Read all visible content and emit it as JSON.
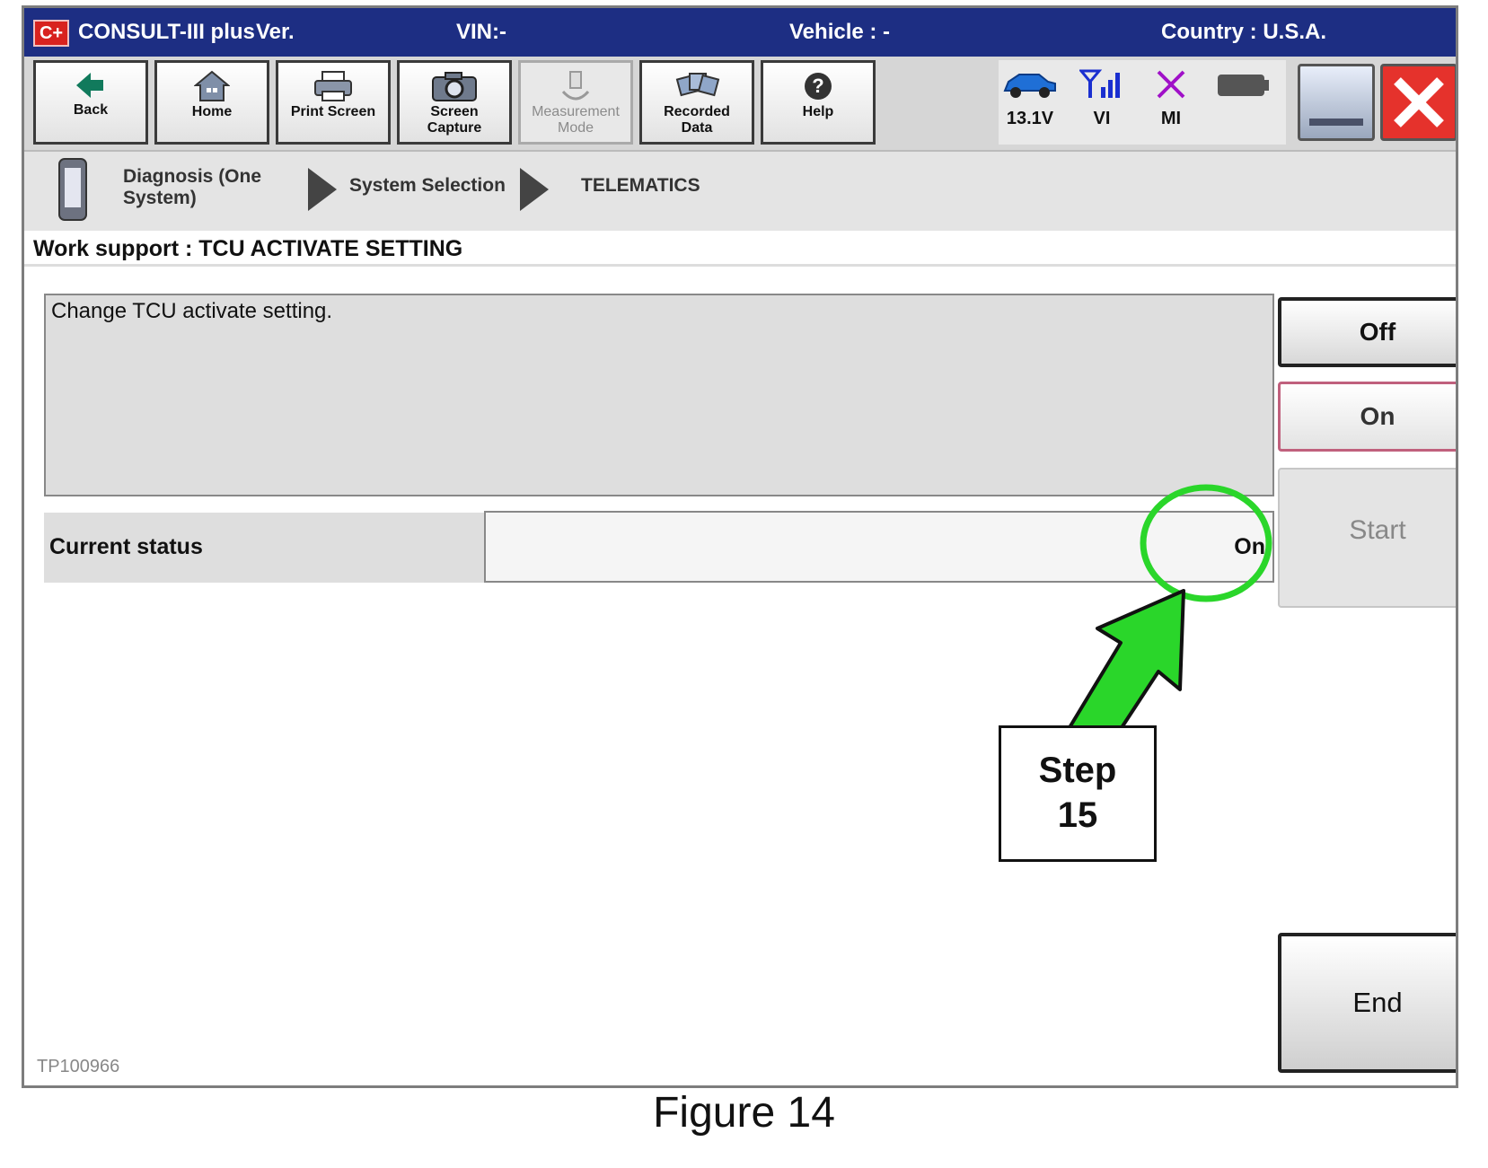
{
  "titlebar": {
    "app": "CONSULT-III plus",
    "ver": "Ver.",
    "vin": "VIN:-",
    "vehicle": "Vehicle : -",
    "country": "Country : U.S.A.",
    "logo": "C+"
  },
  "toolbar": {
    "back": "Back",
    "home": "Home",
    "print_screen": "Print Screen",
    "screen_capture_1": "Screen",
    "screen_capture_2": "Capture",
    "measurement_1": "Measurement",
    "measurement_2": "Mode",
    "recorded_1": "Recorded",
    "recorded_2": "Data",
    "help": "Help"
  },
  "status_icons": {
    "voltage": "13.1V",
    "vi": "VI",
    "mi": "MI",
    "car_color": "#1f6fd6",
    "signal_color": "#1a2fd0",
    "mi_color": "#a010c8"
  },
  "breadcrumb": {
    "step1_line1": "Diagnosis (One",
    "step1_line2": "System)",
    "step2": "System Selection",
    "step3": "TELEMATICS"
  },
  "work": {
    "title": "Work support : TCU ACTIVATE SETTING",
    "message": "Change TCU activate setting.",
    "status_label": "Current status",
    "status_value": "On"
  },
  "buttons": {
    "off": "Off",
    "on": "On",
    "start": "Start",
    "end": "End"
  },
  "doc_id": "TP100966",
  "annotation": {
    "step_line1": "Step",
    "step_line2": "15",
    "highlight_color": "#2ad62a"
  },
  "caption": "Figure 14"
}
